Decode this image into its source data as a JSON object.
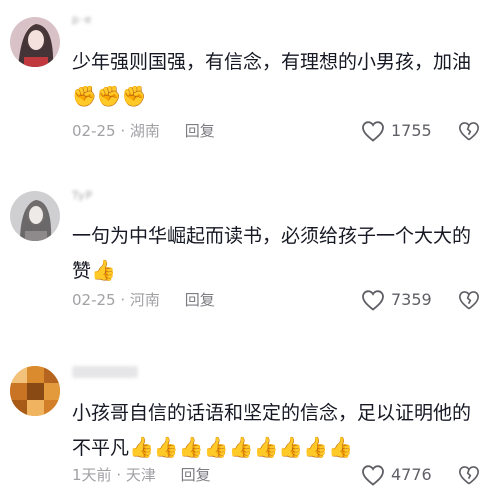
{
  "comments": [
    {
      "username": "p·e",
      "text": "少年强则国强，有信念，有理想的小男孩，加油",
      "emoji": "✊✊✊",
      "date": "02-25",
      "location": "湖南",
      "reply_label": "回复",
      "likes": "1755"
    },
    {
      "username": "TyP",
      "text": "一句为中华崛起而读书，必须给孩子一个大大的赞",
      "emoji": "👍",
      "date": "02-25",
      "location": "河南",
      "reply_label": "回复",
      "likes": "7359"
    },
    {
      "username": "",
      "text": "小孩哥自信的话语和坚定的信念，足以证明他的不平凡",
      "emoji": "👍👍👍👍👍👍👍👍👍",
      "date": "1天前",
      "location": "天津",
      "reply_label": "回复",
      "likes": "4776"
    }
  ],
  "colors": {
    "text": "#161823",
    "meta": "#a1a1a6",
    "icon": "#5f5f66"
  }
}
